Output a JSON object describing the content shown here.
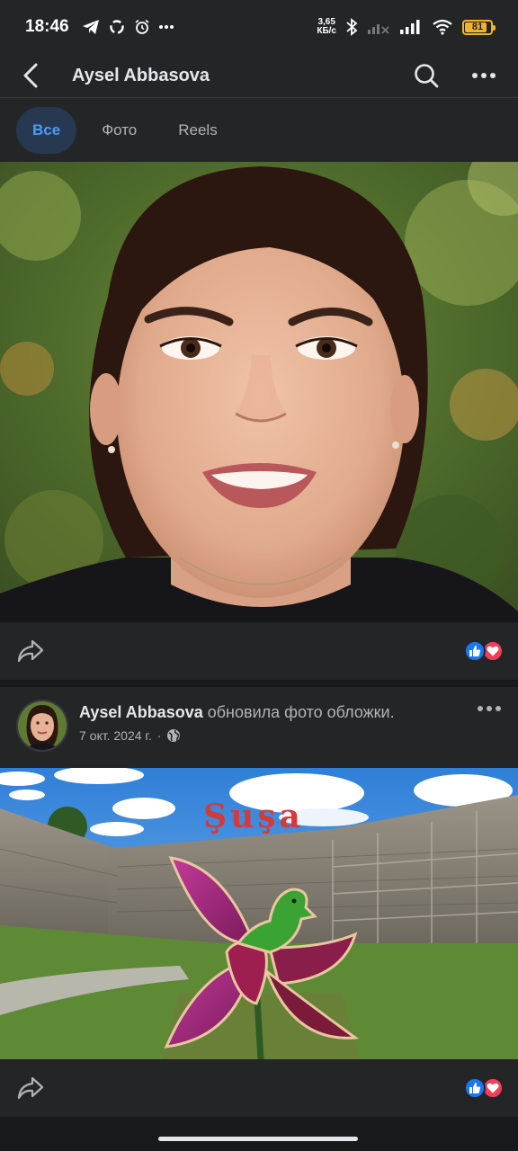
{
  "status_bar": {
    "time": "18:46",
    "speed_value": "3,65",
    "speed_unit": "КБ/с",
    "battery_level": "81",
    "battery_fraction": 0.81
  },
  "app_bar": {
    "title": "Aysel Abbasova",
    "back_icon": "chevron-left-icon",
    "search_icon": "search-icon",
    "more_icon": "more-horizontal-icon"
  },
  "tabs": [
    {
      "label": "Все",
      "active": true
    },
    {
      "label": "Фото",
      "active": false
    },
    {
      "label": "Reels",
      "active": false
    }
  ],
  "post1": {
    "share_icon": "share-icon",
    "reactions": [
      "like-icon",
      "love-icon"
    ]
  },
  "post2": {
    "author": "Aysel Abbasova",
    "action": " обновила фото обложки.",
    "date": "7 окт. 2024 г.",
    "separator": "·",
    "privacy_icon": "globe-icon",
    "cover_sign_text": "Şuşa",
    "share_icon": "share-icon",
    "reactions": [
      "like-icon",
      "love-icon"
    ]
  },
  "colors": {
    "background": "#18191a",
    "surface": "#242526",
    "accent": "#4b9bf5",
    "like": "#1877f2",
    "love": "#f33e58"
  }
}
